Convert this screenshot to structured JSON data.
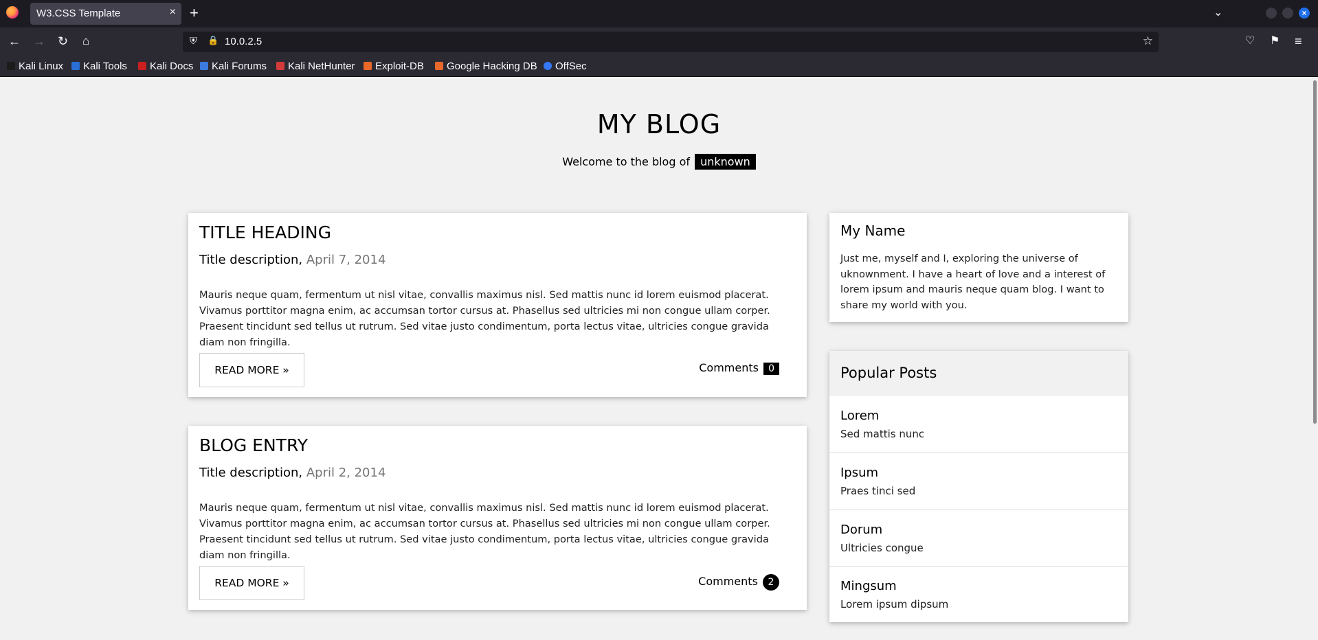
{
  "browser": {
    "tab_title": "W3.CSS Template",
    "tab_close": "×",
    "new_tab": "+",
    "url": "10.0.2.5",
    "bookmarks": [
      {
        "label": "Kali Linux",
        "color": "#1b1b1b"
      },
      {
        "label": "Kali Tools",
        "color": "#2a6fd6"
      },
      {
        "label": "Kali Docs",
        "color": "#c9201f"
      },
      {
        "label": "Kali Forums",
        "color": "#3b7be0"
      },
      {
        "label": "Kali NetHunter",
        "color": "#d33b3b"
      },
      {
        "label": "Exploit-DB",
        "color": "#e8682a"
      },
      {
        "label": "Google Hacking DB",
        "color": "#e8682a"
      },
      {
        "label": "OffSec",
        "color": "#3478f6"
      }
    ]
  },
  "blog": {
    "title": "MY BLOG",
    "welcome_text": "Welcome to the blog of",
    "author": "unknown",
    "posts": [
      {
        "heading": "TITLE HEADING",
        "description": "Title description,",
        "date": "April 7, 2014",
        "body": "Mauris neque quam, fermentum ut nisl vitae, convallis maximus nisl. Sed mattis nunc id lorem euismod placerat. Vivamus porttitor magna enim, ac accumsan tortor cursus at. Phasellus sed ultricies mi non congue ullam corper. Praesent tincidunt sed tellus ut rutrum. Sed vitae justo condimentum, porta lectus vitae, ultricies congue gravida diam non fringilla.",
        "read_more": "READ MORE »",
        "comments_label": "Comments",
        "comments_count": "0"
      },
      {
        "heading": "BLOG ENTRY",
        "description": "Title description,",
        "date": "April 2, 2014",
        "body": "Mauris neque quam, fermentum ut nisl vitae, convallis maximus nisl. Sed mattis nunc id lorem euismod placerat. Vivamus porttitor magna enim, ac accumsan tortor cursus at. Phasellus sed ultricies mi non congue ullam corper. Praesent tincidunt sed tellus ut rutrum. Sed vitae justo condimentum, porta lectus vitae, ultricies congue gravida diam non fringilla.",
        "read_more": "READ MORE »",
        "comments_label": "Comments",
        "comments_count": "2"
      }
    ],
    "about": {
      "name": "My Name",
      "text": "Just me, myself and I, exploring the universe of uknownment. I have a heart of love and a interest of lorem ipsum and mauris neque quam blog. I want to share my world with you."
    },
    "popular": {
      "heading": "Popular Posts",
      "items": [
        {
          "title": "Lorem",
          "subtitle": "Sed mattis nunc"
        },
        {
          "title": "Ipsum",
          "subtitle": "Praes tinci sed"
        },
        {
          "title": "Dorum",
          "subtitle": "Ultricies congue"
        },
        {
          "title": "Mingsum",
          "subtitle": "Lorem ipsum dipsum"
        }
      ]
    }
  }
}
